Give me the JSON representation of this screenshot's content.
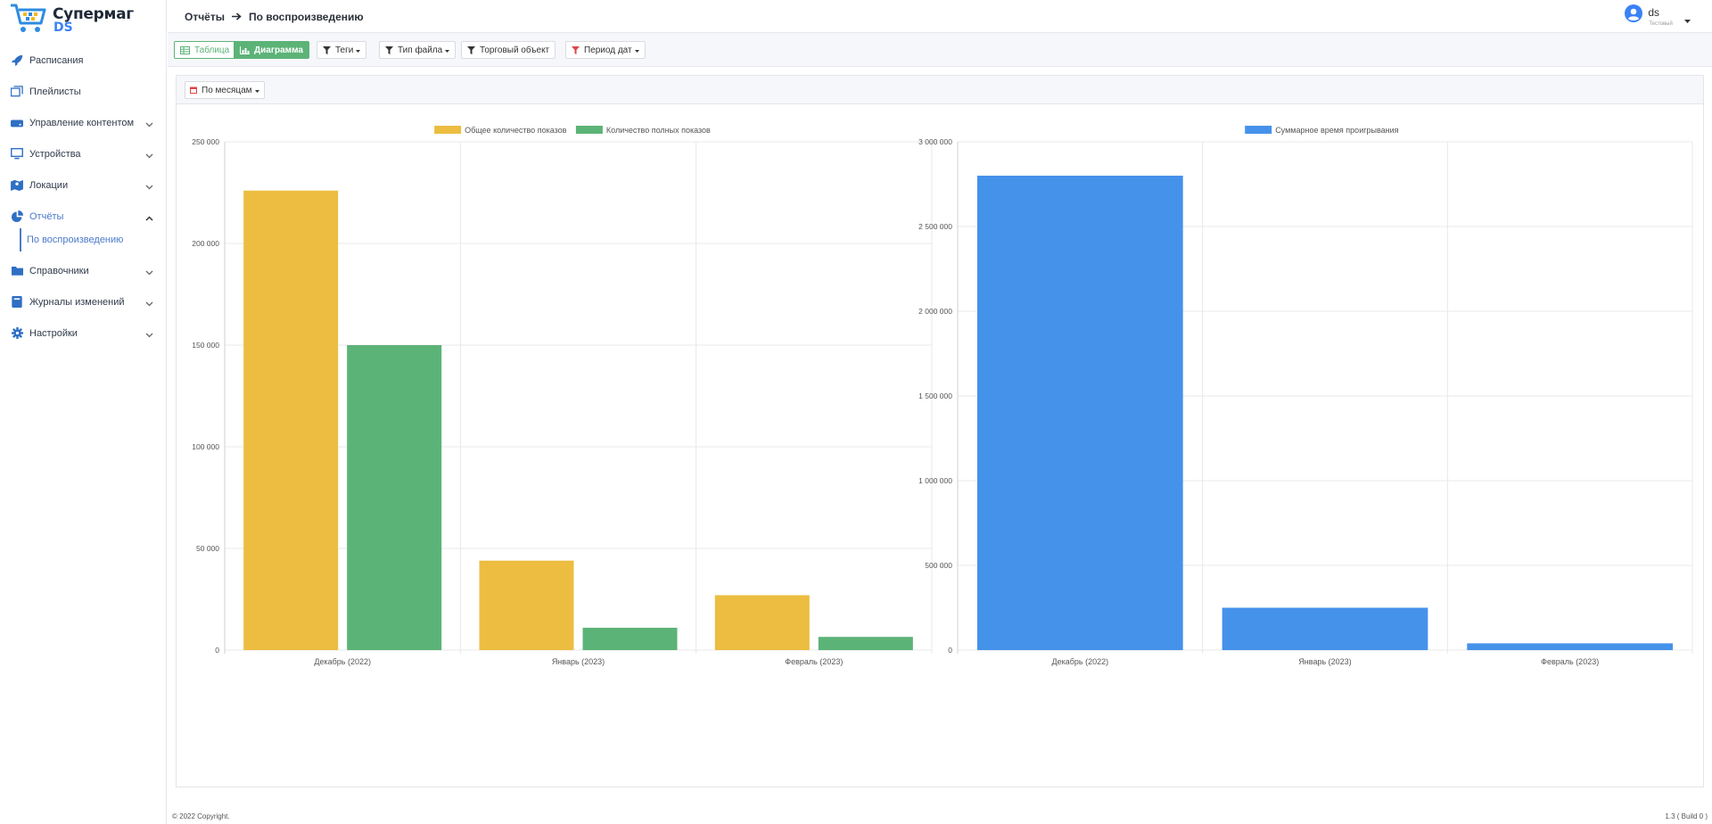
{
  "brand": {
    "line1": "Супермаг",
    "line2": "DS"
  },
  "sidebar": {
    "items": [
      {
        "label": "Расписания",
        "icon": "rocket-icon",
        "expandable": false
      },
      {
        "label": "Плейлисты",
        "icon": "playlist-icon",
        "expandable": false
      },
      {
        "label": "Управление контентом",
        "icon": "drive-icon",
        "expandable": true
      },
      {
        "label": "Устройства",
        "icon": "monitor-icon",
        "expandable": true
      },
      {
        "label": "Локации",
        "icon": "map-icon",
        "expandable": true
      },
      {
        "label": "Отчёты",
        "icon": "pie-chart-icon",
        "expandable": true,
        "expanded": true,
        "active": true
      },
      {
        "label": "Справочники",
        "icon": "folder-icon",
        "expandable": true
      },
      {
        "label": "Журналы изменений",
        "icon": "book-icon",
        "expandable": true
      },
      {
        "label": "Настройки",
        "icon": "gear-icon",
        "expandable": true
      }
    ],
    "subitem": "По воспроизведению"
  },
  "header": {
    "breadcrumb_parent": "Отчёты",
    "breadcrumb_current": "По воспроизведению",
    "user_name": "ds",
    "user_role": "Тестовый"
  },
  "toolbar": {
    "view_table": "Таблица",
    "view_chart": "Диаграмма",
    "filters": [
      "Теги",
      "Тип файла",
      "Торговый объект",
      "Период дат"
    ]
  },
  "panel": {
    "group_by": "По месяцам"
  },
  "chart_data": [
    {
      "type": "bar",
      "categories": [
        "Декабрь (2022)",
        "Январь (2023)",
        "Февраль (2023)"
      ],
      "series": [
        {
          "name": "Общее количество показов",
          "color": "#ecbd40",
          "values": [
            226000,
            44000,
            27000
          ]
        },
        {
          "name": "Количество полных показов",
          "color": "#5cb377",
          "values": [
            150000,
            11000,
            6500
          ]
        }
      ],
      "ylim": [
        0,
        250000
      ],
      "yticks": [
        0,
        50000,
        100000,
        150000,
        200000,
        250000
      ],
      "ytick_labels": [
        "0",
        "50 000",
        "100 000",
        "150 000",
        "200 000",
        "250 000"
      ],
      "legend": "top-center",
      "grid": true
    },
    {
      "type": "bar",
      "categories": [
        "Декабрь (2022)",
        "Январь (2023)",
        "Февраль (2023)"
      ],
      "series": [
        {
          "name": "Суммарное время проигрывания",
          "color": "#4592ea",
          "values": [
            2800000,
            250000,
            40000
          ]
        }
      ],
      "ylim": [
        0,
        3000000
      ],
      "yticks": [
        0,
        500000,
        1000000,
        1500000,
        2000000,
        2500000,
        3000000
      ],
      "ytick_labels": [
        "0",
        "500 000",
        "1 000 000",
        "1 500 000",
        "2 000 000",
        "2 500 000",
        "3 000 000"
      ],
      "legend": "top-center",
      "grid": true
    }
  ],
  "footer": {
    "copyright": "© 2022 Copyright.",
    "build": "1.3 ( Build 0 )"
  }
}
